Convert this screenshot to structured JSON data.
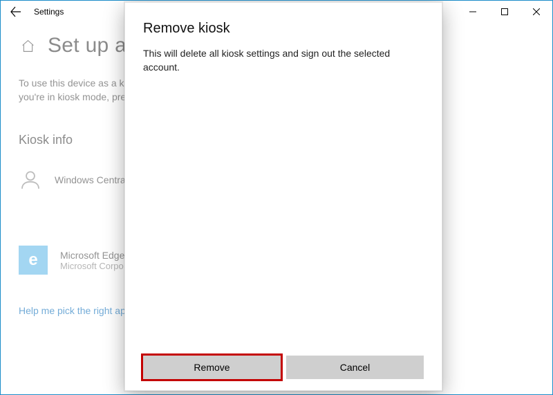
{
  "window": {
    "title": "Settings"
  },
  "page": {
    "heading": "Set up a k",
    "description_line1": "To use this device as a kio",
    "description_line2": "you're in kiosk mode, pre",
    "section_heading": "Kiosk info",
    "account_name": "Windows Central",
    "app_name": "Microsoft Edge",
    "app_publisher": "Microsoft Corpo",
    "help_link": "Help me pick the right ap"
  },
  "dialog": {
    "title": "Remove kiosk",
    "body": "This will delete all kiosk settings and sign out the selected account.",
    "remove_label": "Remove",
    "cancel_label": "Cancel"
  }
}
